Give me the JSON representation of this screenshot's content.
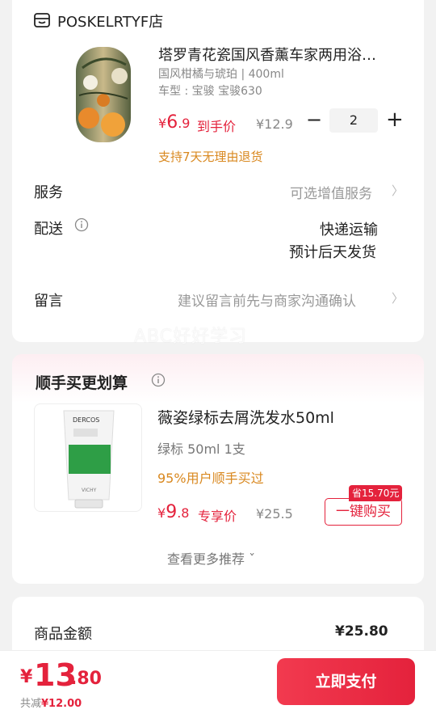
{
  "store": {
    "name": "POSKELRTYF店",
    "icon": "store-icon"
  },
  "product": {
    "title": "塔罗青花瓷国风香薰车家两用浴…",
    "spec": "国风柑橘与琥珀 | 400ml",
    "car_model": "车型 : 宝骏 宝骏630",
    "price_currency": "¥",
    "price_int": "6",
    "price_dec": ".9",
    "price_label": "到手价",
    "original_price": "¥12.9",
    "quantity": "2",
    "minus": "−",
    "plus": "+",
    "return_policy": "支持7天无理由退货"
  },
  "service": {
    "label": "服务",
    "value": "可选增值服务",
    "chevron": "〉"
  },
  "delivery": {
    "label": "配送",
    "method": "快递运输",
    "eta": "预计后天发货"
  },
  "message": {
    "label": "留言",
    "placeholder": "建议留言前先与商家沟通确认",
    "chevron": "〉"
  },
  "watermark": "ABC好好学习",
  "addon": {
    "section_title": "顺手买更划算",
    "title": "薇姿绿标去屑洗发水50ml",
    "spec": "绿标 50ml 1支",
    "social": "95%用户顺手买过",
    "price_currency": "¥",
    "price_int": "9",
    "price_dec": ".8",
    "price_label": "专享价",
    "original_price": "¥25.5",
    "save_badge": "省15.70元",
    "buy_button": "一键购买",
    "more": "查看更多推荐 ˇ",
    "image_brand": "DERCOS",
    "image_footer": "VICHY"
  },
  "summary": {
    "label": "商品金额",
    "value": "¥25.80"
  },
  "bottom": {
    "currency": "¥",
    "total_int": "13",
    "total_dec": ".80",
    "saved_label": "共减",
    "saved_value": "¥12.00",
    "pay_button": "立即支付"
  },
  "colors": {
    "accent": "#e4223c",
    "orange": "#d9881f"
  }
}
